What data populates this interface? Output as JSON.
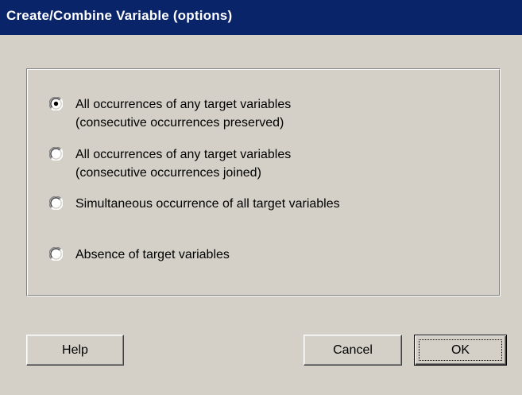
{
  "window": {
    "title": "Create/Combine Variable (options)"
  },
  "options": {
    "selected_index": 0,
    "items": [
      {
        "line1": "All occurrences of any target variables",
        "line2": "(consecutive occurrences preserved)",
        "checked": true
      },
      {
        "line1": "All occurrences of any target variables",
        "line2": "(consecutive occurrences joined)",
        "checked": false
      },
      {
        "line1": "Simultaneous occurrence of all target variables",
        "line2": "",
        "checked": false
      },
      {
        "line1": "Absence of target variables",
        "line2": "",
        "checked": false
      }
    ]
  },
  "buttons": {
    "help": "Help",
    "cancel": "Cancel",
    "ok": "OK"
  },
  "colors": {
    "titlebar": "#0a246a",
    "dialog_bg": "#d4d0c8"
  }
}
